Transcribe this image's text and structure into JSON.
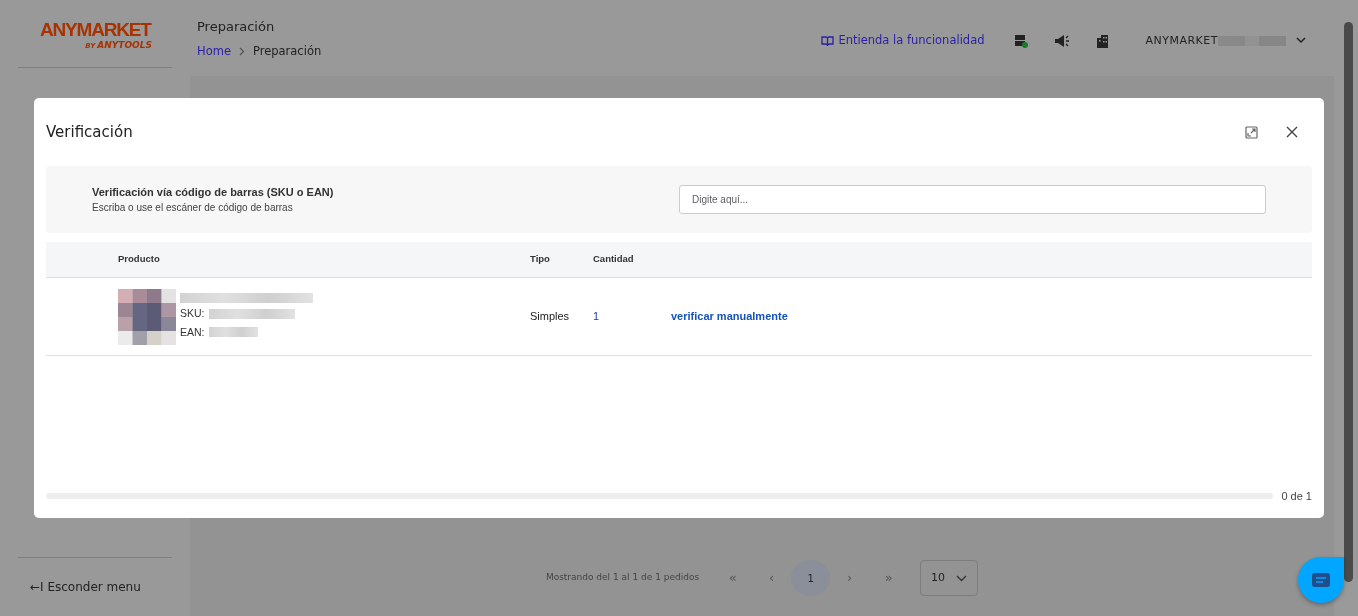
{
  "sidebar": {
    "logo": {
      "brand": "ANYMARKET",
      "tagline_by": "BY",
      "tagline": "ANYTOOLS"
    },
    "hide_menu": {
      "icon": "←I",
      "label": "Esconder menu"
    }
  },
  "header": {
    "title": "Preparación",
    "breadcrumb": [
      {
        "label": "Home",
        "link": true
      },
      {
        "label": "Preparación",
        "link": false
      }
    ],
    "help_link": "Entienda la funcionalidad",
    "account": "ANYMARKET"
  },
  "pagination": {
    "summary": "Mostrando del 1 al 1 de 1 pedidos",
    "first": "«",
    "prev": "‹",
    "pages": [
      {
        "label": "1",
        "selected": true
      }
    ],
    "next": "›",
    "last": "»",
    "page_size": "10"
  },
  "modal": {
    "title": "Verificación",
    "barcode": {
      "title": "Verificación vía código de barras (SKU o EAN)",
      "subtitle": "Escriba o use el escáner de código de barras",
      "placeholder": "Digite aquí..."
    },
    "table": {
      "columns": [
        "Producto",
        "Tipo",
        "Cantidad"
      ],
      "rows": [
        {
          "sku_label": "SKU:",
          "ean_label": "EAN:",
          "type": "Simples",
          "quantity": "1",
          "action": "verificar manualmente"
        }
      ]
    },
    "progress": {
      "level": 0,
      "reading": "0 de 1"
    }
  }
}
